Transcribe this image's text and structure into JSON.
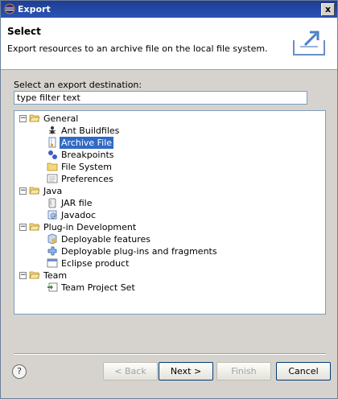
{
  "window": {
    "title": "Export",
    "close_label": "x"
  },
  "header": {
    "title": "Select",
    "description": "Export resources to an archive file on the local file system."
  },
  "select_label": "Select an export destination:",
  "filter": {
    "value": "type filter text"
  },
  "tree": [
    {
      "label": "General",
      "icon": "folder-open-icon",
      "expander": "−",
      "children": [
        {
          "label": "Ant Buildfiles",
          "icon": "ant-icon"
        },
        {
          "label": "Archive File",
          "icon": "archive-file-icon",
          "selected": true
        },
        {
          "label": "Breakpoints",
          "icon": "breakpoints-icon"
        },
        {
          "label": "File System",
          "icon": "folder-icon"
        },
        {
          "label": "Preferences",
          "icon": "preferences-icon"
        }
      ]
    },
    {
      "label": "Java",
      "icon": "folder-open-icon",
      "expander": "−",
      "children": [
        {
          "label": "JAR file",
          "icon": "jar-file-icon"
        },
        {
          "label": "Javadoc",
          "icon": "javadoc-icon"
        }
      ]
    },
    {
      "label": "Plug-in Development",
      "icon": "folder-open-icon",
      "expander": "−",
      "children": [
        {
          "label": "Deployable features",
          "icon": "feature-icon"
        },
        {
          "label": "Deployable plug-ins and fragments",
          "icon": "plugin-icon"
        },
        {
          "label": "Eclipse product",
          "icon": "product-icon"
        }
      ]
    },
    {
      "label": "Team",
      "icon": "folder-open-icon",
      "expander": "−",
      "children": [
        {
          "label": "Team Project Set",
          "icon": "team-project-set-icon"
        }
      ]
    }
  ],
  "buttons": {
    "help": "?",
    "back": "< Back",
    "next": "Next >",
    "finish": "Finish",
    "cancel": "Cancel"
  }
}
